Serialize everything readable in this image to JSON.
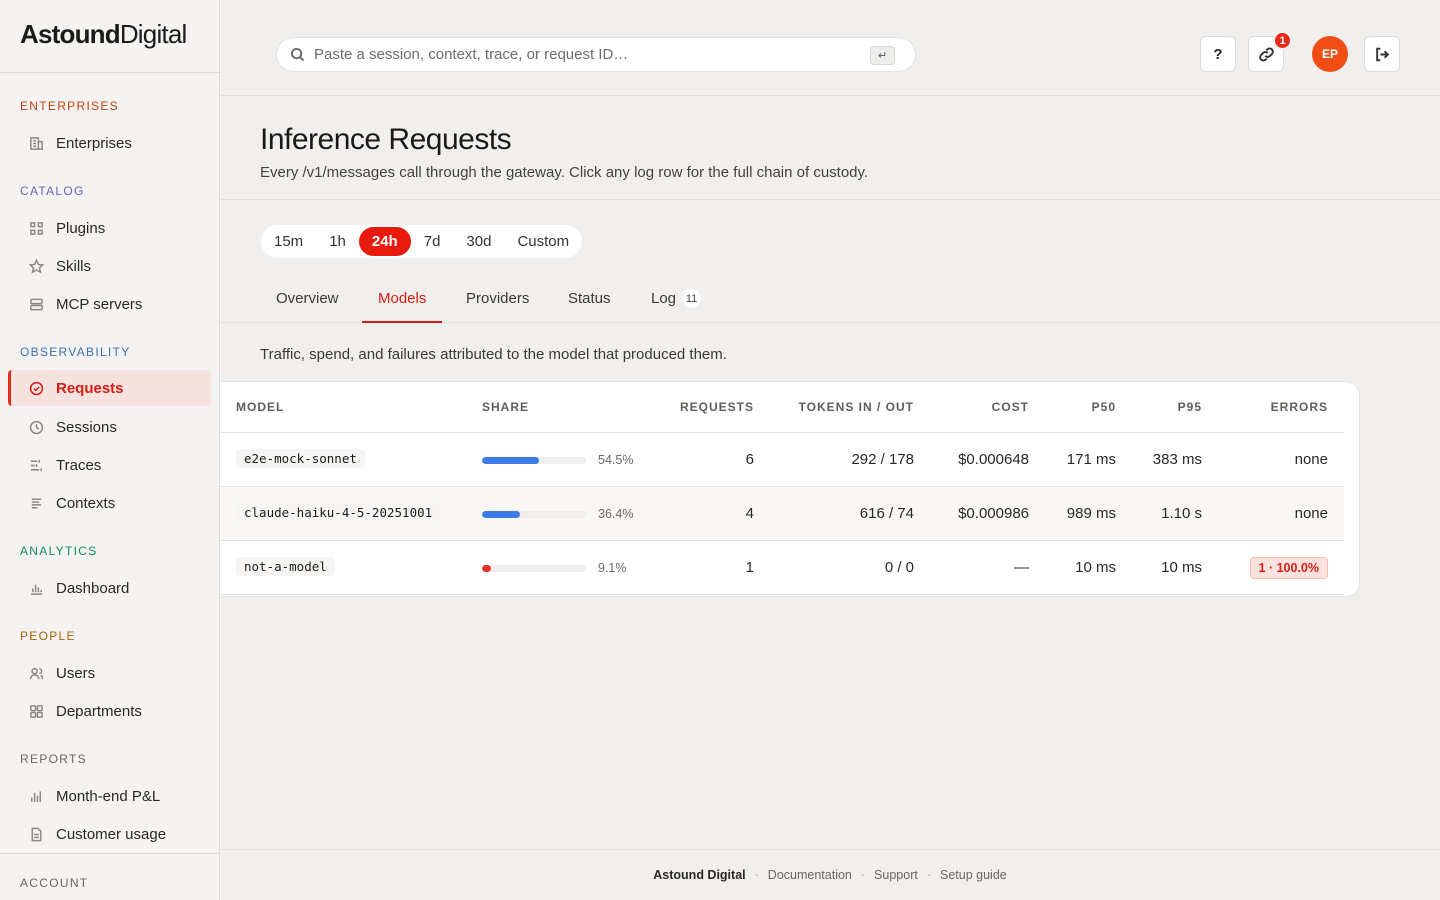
{
  "brand": {
    "part1": "Astound",
    "part2": "Digital"
  },
  "sidebar": {
    "sections": [
      {
        "label": "ENTERPRISES",
        "color": "#c2410c"
      },
      {
        "label": "CATALOG",
        "color": "#6b63b5"
      },
      {
        "label": "OBSERVABILITY",
        "color": "#3b6fb6"
      },
      {
        "label": "ANALYTICS",
        "color": "#0f8a5f"
      },
      {
        "label": "PEOPLE",
        "color": "#a16207"
      },
      {
        "label": "REPORTS",
        "color": "#6a6763"
      },
      {
        "label": "ACCOUNT",
        "color": "#6a6763"
      }
    ],
    "items": [
      {
        "label": "Enterprises",
        "icon": "building-icon"
      },
      {
        "label": "Plugins",
        "icon": "grid-icon"
      },
      {
        "label": "Skills",
        "icon": "star-icon"
      },
      {
        "label": "MCP servers",
        "icon": "server-icon"
      },
      {
        "label": "Requests",
        "icon": "check-circle-icon"
      },
      {
        "label": "Sessions",
        "icon": "clock-icon"
      },
      {
        "label": "Traces",
        "icon": "traces-icon"
      },
      {
        "label": "Contexts",
        "icon": "lines-icon"
      },
      {
        "label": "Dashboard",
        "icon": "bar-chart-icon"
      },
      {
        "label": "Users",
        "icon": "users-icon"
      },
      {
        "label": "Departments",
        "icon": "squares-icon"
      },
      {
        "label": "Month-end P&L",
        "icon": "bar-chart-icon"
      },
      {
        "label": "Customer usage",
        "icon": "document-icon"
      }
    ]
  },
  "topbar": {
    "search_placeholder": "Paste a session, context, trace, or request ID…",
    "kbd_hint": "↵",
    "help_label": "?",
    "notification_count": "1",
    "avatar_initials": "EP"
  },
  "page": {
    "title": "Inference Requests",
    "subtitle": "Every /v1/messages call through the gateway. Click any log row for the full chain of custody.",
    "time_ranges": [
      "15m",
      "1h",
      "24h",
      "7d",
      "30d",
      "Custom"
    ],
    "selected_range": "24h",
    "tabs": [
      {
        "label": "Overview"
      },
      {
        "label": "Models"
      },
      {
        "label": "Providers"
      },
      {
        "label": "Status"
      },
      {
        "label": "Log",
        "count": "11"
      }
    ],
    "active_tab": "Models",
    "description": "Traffic, spend, and failures attributed to the model that produced them."
  },
  "table": {
    "headers": {
      "model": "MODEL",
      "share": "SHARE",
      "requests": "REQUESTS",
      "tokens": "TOKENS IN / OUT",
      "cost": "COST",
      "p50": "P50",
      "p95": "P95",
      "errors": "ERRORS"
    },
    "rows": [
      {
        "model": "e2e-mock-sonnet",
        "share": 0.545,
        "share_label": "54.5%",
        "share_color": "#3b7ce6",
        "requests": "6",
        "tokens": "292 / 178",
        "cost": "$0.000648",
        "p50": "171 ms",
        "p95": "383 ms",
        "errors": "none",
        "error_badge": false
      },
      {
        "model": "claude-haiku-4-5-20251001",
        "share": 0.364,
        "share_label": "36.4%",
        "share_color": "#3b7ce6",
        "requests": "4",
        "tokens": "616 / 74",
        "cost": "$0.000986",
        "p50": "989 ms",
        "p95": "1.10 s",
        "errors": "none",
        "error_badge": false
      },
      {
        "model": "not-a-model",
        "share": 0.091,
        "share_label": "9.1%",
        "share_color": "#e6322a",
        "requests": "1",
        "tokens": "0 / 0",
        "cost": "—",
        "p50": "10 ms",
        "p95": "10 ms",
        "errors": "1 · 100.0%",
        "error_badge": true
      }
    ]
  },
  "footer": {
    "brand": "Astound Digital",
    "links": [
      "Documentation",
      "Support",
      "Setup guide"
    ]
  }
}
